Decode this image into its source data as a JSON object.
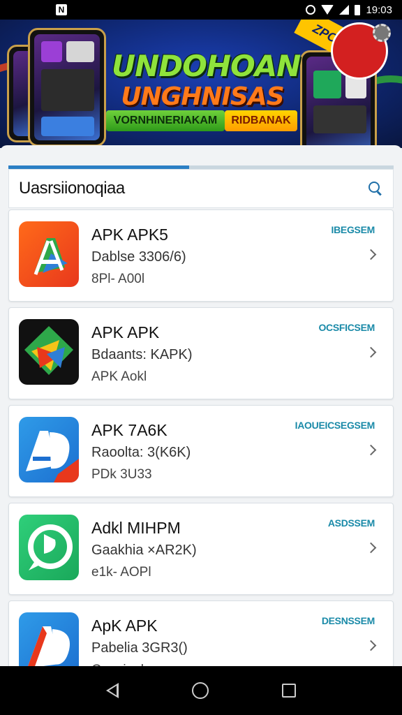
{
  "status_bar": {
    "time": "19:03",
    "notification_icon": "N"
  },
  "banner": {
    "title_line1": "UNDOHOAN",
    "title_line2": "UNGHNISAS",
    "pill_green": "VORNHINERIAKAM",
    "pill_yellow": "RIDBANAK",
    "corner_tag": "ZPO"
  },
  "tabs": {
    "progress_fraction": 0.47
  },
  "header": {
    "title": "Uasrsiionoqiaa"
  },
  "apps": [
    {
      "name": "APK APK5",
      "subtitle": "Dablse 3306/6)",
      "meta": "8Pl- A00l",
      "action": "IBEGSEM"
    },
    {
      "name": "APK APK",
      "subtitle": "Bdaants: KAPK)",
      "meta": "APK Aokl",
      "action": "OCSFICSEM"
    },
    {
      "name": "APK 7A6K",
      "subtitle": "Raoolta: 3(K6K)",
      "meta": "PDk 3U33",
      "action": "IAOUEICSEGSEM"
    },
    {
      "name": "Adkl MIHPM",
      "subtitle": "Gaakhia ×AR2K)",
      "meta": "e1k- AOPl",
      "action": "ASDSSEM"
    },
    {
      "name": "ApK APK",
      "subtitle": "Pabelia 3GR3()",
      "meta": "Gnocinel",
      "action": "DESNSSEM"
    }
  ],
  "colors": {
    "accent": "#2b7fc4",
    "action_text": "#1a8aa8"
  }
}
